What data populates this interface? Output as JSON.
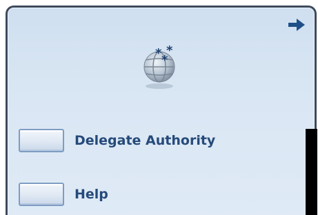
{
  "panel": {
    "collapse_icon": "arrow-right-icon",
    "header_icon": "globe-icon",
    "items": [
      {
        "label": "Delegate Authority",
        "icon": "button-box-icon"
      },
      {
        "label": "Help",
        "icon": "button-box-icon"
      }
    ]
  },
  "colors": {
    "panel_background": "#d6e4f2",
    "panel_border": "#3d4a5c",
    "label_text": "#254a7a",
    "arrow": "#1f4f86",
    "scrollbar": "#000000"
  }
}
